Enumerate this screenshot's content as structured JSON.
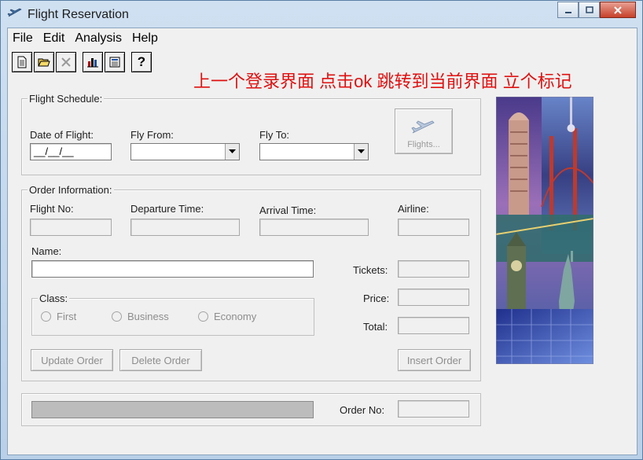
{
  "window": {
    "title": "Flight Reservation"
  },
  "menu": [
    "File",
    "Edit",
    "Analysis",
    "Help"
  ],
  "toolbar": {
    "buttons": [
      {
        "name": "new-order-icon",
        "glyph": "new"
      },
      {
        "name": "open-order-icon",
        "glyph": "open"
      },
      {
        "name": "delete-icon",
        "glyph": "x"
      },
      {
        "name": "chart-icon",
        "glyph": "chart"
      },
      {
        "name": "calculator-icon",
        "glyph": "calc"
      },
      {
        "name": "help-icon",
        "glyph": "?"
      }
    ]
  },
  "annotation": "上一个登录界面 点击ok 跳转到当前界面 立个标记",
  "flight_schedule": {
    "title": "Flight Schedule:",
    "date_label": "Date of Flight:",
    "date_value": "__/__/__",
    "from_label": "Fly From:",
    "to_label": "Fly To:",
    "flights_button": "Flights..."
  },
  "order_info": {
    "title": "Order Information:",
    "flight_no_label": "Flight No:",
    "departure_label": "Departure Time:",
    "arrival_label": "Arrival Time:",
    "airline_label": "Airline:",
    "name_label": "Name:",
    "tickets_label": "Tickets:",
    "price_label": "Price:",
    "total_label": "Total:",
    "class_title": "Class:",
    "class_options": [
      "First",
      "Business",
      "Economy"
    ],
    "update_button": "Update Order",
    "delete_button": "Delete Order",
    "insert_button": "Insert Order"
  },
  "status": {
    "order_no_label": "Order No:"
  }
}
